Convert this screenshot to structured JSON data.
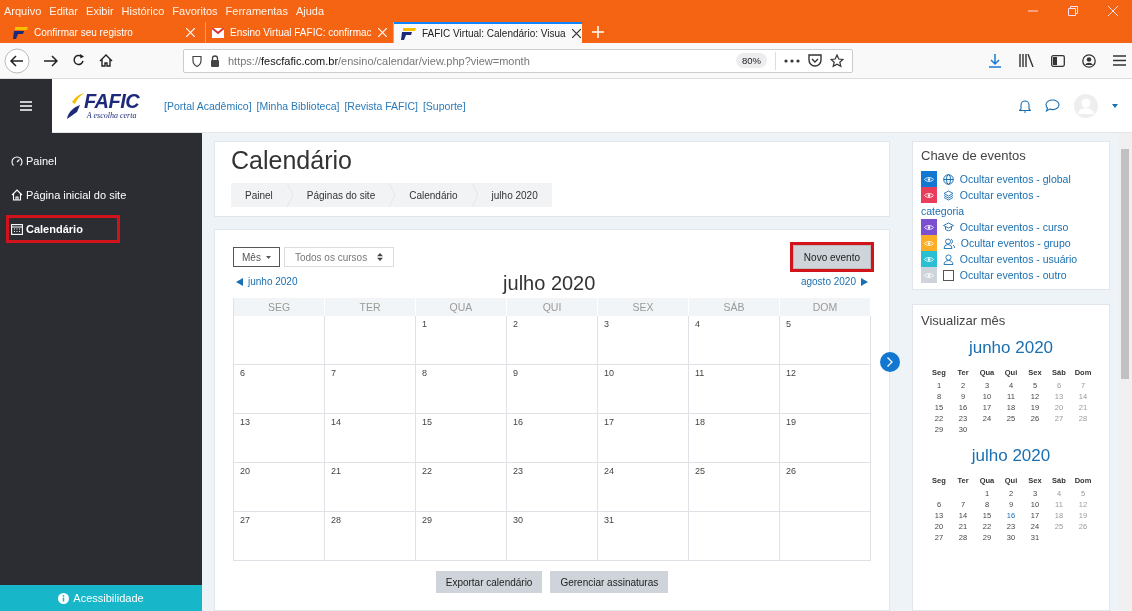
{
  "browser": {
    "menu": [
      "Arquivo",
      "Editar",
      "Exibir",
      "Histórico",
      "Favoritos",
      "Ferramentas",
      "Ajuda"
    ],
    "tabs": [
      {
        "title": "Confirmar seu registro",
        "kind": "fafic",
        "selected": false
      },
      {
        "title": "Ensino Virtual FAFIC: confirmac",
        "kind": "mail",
        "selected": false
      },
      {
        "title": "FAFIC Virtual: Calendário: Visua",
        "kind": "fafic",
        "selected": true
      }
    ],
    "url": "https://**fescfafic.com.br**/ensino/calendar/view.php?view=month",
    "zoom": "80%"
  },
  "navbar": {
    "logo_text": "FAFIC",
    "logo_tagline": "A escolha certa",
    "links": [
      "[Portal Acadêmico]",
      "[Minha Biblioteca]",
      "[Revista FAFIC]",
      "[Suporte]"
    ]
  },
  "sidebar": {
    "items": [
      {
        "label": "Painel",
        "kind": "dashboard",
        "selected": false,
        "annotated": false
      },
      {
        "label": "Página inicial do site",
        "kind": "home",
        "selected": false,
        "annotated": false
      },
      {
        "label": "Calendário",
        "kind": "calendar",
        "selected": true,
        "annotated": true
      }
    ],
    "footer": "Acessibilidade"
  },
  "header": {
    "title": "Calendário",
    "breadcrumbs": [
      "Painel",
      "Páginas do site",
      "Calendário",
      "julho 2020"
    ]
  },
  "calendar": {
    "view_select": "Mês",
    "course_select": "Todos os cursos",
    "new_event": {
      "label": "Novo evento",
      "annotated": true
    },
    "prev": "junho 2020",
    "month": "julho 2020",
    "next": "agosto 2020",
    "weekdays": [
      "SEG",
      "TER",
      "QUA",
      "QUI",
      "SEX",
      "SÁB",
      "DOM"
    ],
    "weeks": [
      [
        {
          "kind": "blank"
        },
        {
          "kind": "blank"
        },
        {
          "kind": "day",
          "d": "1"
        },
        {
          "kind": "day",
          "d": "2"
        },
        {
          "kind": "day",
          "d": "3"
        },
        {
          "kind": "day",
          "d": "4"
        },
        {
          "kind": "day",
          "d": "5"
        }
      ],
      [
        {
          "kind": "day",
          "d": "6"
        },
        {
          "kind": "day",
          "d": "7"
        },
        {
          "kind": "day",
          "d": "8"
        },
        {
          "kind": "day",
          "d": "9"
        },
        {
          "kind": "day",
          "d": "10"
        },
        {
          "kind": "day",
          "d": "11"
        },
        {
          "kind": "day",
          "d": "12"
        }
      ],
      [
        {
          "kind": "day",
          "d": "13"
        },
        {
          "kind": "day",
          "d": "14"
        },
        {
          "kind": "day",
          "d": "15"
        },
        {
          "kind": "day",
          "d": "16"
        },
        {
          "kind": "day",
          "d": "17"
        },
        {
          "kind": "day",
          "d": "18"
        },
        {
          "kind": "day",
          "d": "19"
        }
      ],
      [
        {
          "kind": "day",
          "d": "20"
        },
        {
          "kind": "day",
          "d": "21"
        },
        {
          "kind": "day",
          "d": "22"
        },
        {
          "kind": "day",
          "d": "23"
        },
        {
          "kind": "day",
          "d": "24"
        },
        {
          "kind": "day",
          "d": "25"
        },
        {
          "kind": "day",
          "d": "26"
        }
      ],
      [
        {
          "kind": "day",
          "d": "27"
        },
        {
          "kind": "day",
          "d": "28"
        },
        {
          "kind": "day",
          "d": "29"
        },
        {
          "kind": "day",
          "d": "30"
        },
        {
          "kind": "day",
          "d": "31"
        },
        {
          "kind": "blank"
        },
        {
          "kind": "blank"
        }
      ]
    ],
    "buttons": [
      "Exportar calendário",
      "Gerenciar assinaturas"
    ]
  },
  "event_key": {
    "title": "Chave de eventos",
    "items": [
      {
        "label": "Ocultar eventos - global",
        "kind": "global",
        "color": "#1177d1"
      },
      {
        "label": "Ocultar eventos - categoria",
        "kind": "category",
        "color": "#e83e5c"
      },
      {
        "label": "Ocultar eventos - curso",
        "kind": "course",
        "color": "#7b4fd1"
      },
      {
        "label": "Ocultar eventos - grupo",
        "kind": "group",
        "color": "#fbad26"
      },
      {
        "label": "Ocultar eventos - usuário",
        "kind": "user",
        "color": "#2bbfd3"
      },
      {
        "label": "Ocultar eventos - outro",
        "kind": "other",
        "color": "#ced4da"
      }
    ]
  },
  "month_view": {
    "title": "Visualizar mês",
    "months": [
      {
        "name": "junho 2020",
        "weekdays": [
          "Seg",
          "Ter",
          "Qua",
          "Qui",
          "Sex",
          "Sáb",
          "Dom"
        ],
        "weeks": [
          [
            {
              "kind": "day",
              "d": "1",
              "today": false
            },
            {
              "kind": "day",
              "d": "2",
              "today": false
            },
            {
              "kind": "day",
              "d": "3",
              "today": false
            },
            {
              "kind": "day",
              "d": "4",
              "today": false
            },
            {
              "kind": "day",
              "d": "5",
              "today": false
            },
            {
              "kind": "day",
              "d": "6",
              "today": false
            },
            {
              "kind": "day",
              "d": "7",
              "today": false
            }
          ],
          [
            {
              "kind": "day",
              "d": "8",
              "today": false
            },
            {
              "kind": "day",
              "d": "9",
              "today": false
            },
            {
              "kind": "day",
              "d": "10",
              "today": false
            },
            {
              "kind": "day",
              "d": "11",
              "today": false
            },
            {
              "kind": "day",
              "d": "12",
              "today": false
            },
            {
              "kind": "day",
              "d": "13",
              "today": false
            },
            {
              "kind": "day",
              "d": "14",
              "today": false
            }
          ],
          [
            {
              "kind": "day",
              "d": "15",
              "today": false
            },
            {
              "kind": "day",
              "d": "16",
              "today": false
            },
            {
              "kind": "day",
              "d": "17",
              "today": false
            },
            {
              "kind": "day",
              "d": "18",
              "today": false
            },
            {
              "kind": "day",
              "d": "19",
              "today": false
            },
            {
              "kind": "day",
              "d": "20",
              "today": false
            },
            {
              "kind": "day",
              "d": "21",
              "today": false
            }
          ],
          [
            {
              "kind": "day",
              "d": "22",
              "today": false
            },
            {
              "kind": "day",
              "d": "23",
              "today": false
            },
            {
              "kind": "day",
              "d": "24",
              "today": false
            },
            {
              "kind": "day",
              "d": "25",
              "today": false
            },
            {
              "kind": "day",
              "d": "26",
              "today": false
            },
            {
              "kind": "day",
              "d": "27",
              "today": false
            },
            {
              "kind": "day",
              "d": "28",
              "today": false
            }
          ],
          [
            {
              "kind": "day",
              "d": "29",
              "today": false
            },
            {
              "kind": "day",
              "d": "30",
              "today": false
            },
            {
              "kind": "blank"
            },
            {
              "kind": "blank"
            },
            {
              "kind": "blank"
            },
            {
              "kind": "blank"
            },
            {
              "kind": "blank"
            }
          ]
        ]
      },
      {
        "name": "julho 2020",
        "weekdays": [
          "Seg",
          "Ter",
          "Qua",
          "Qui",
          "Sex",
          "Sáb",
          "Dom"
        ],
        "weeks": [
          [
            {
              "kind": "blank"
            },
            {
              "kind": "blank"
            },
            {
              "kind": "day",
              "d": "1",
              "today": false
            },
            {
              "kind": "day",
              "d": "2",
              "today": false
            },
            {
              "kind": "day",
              "d": "3",
              "today": false
            },
            {
              "kind": "day",
              "d": "4",
              "today": false
            },
            {
              "kind": "day",
              "d": "5",
              "today": false
            }
          ],
          [
            {
              "kind": "day",
              "d": "6",
              "today": false
            },
            {
              "kind": "day",
              "d": "7",
              "today": false
            },
            {
              "kind": "day",
              "d": "8",
              "today": false
            },
            {
              "kind": "day",
              "d": "9",
              "today": false
            },
            {
              "kind": "day",
              "d": "10",
              "today": false
            },
            {
              "kind": "day",
              "d": "11",
              "today": false
            },
            {
              "kind": "day",
              "d": "12",
              "today": false
            }
          ],
          [
            {
              "kind": "day",
              "d": "13",
              "today": false
            },
            {
              "kind": "day",
              "d": "14",
              "today": false
            },
            {
              "kind": "day",
              "d": "15",
              "today": false
            },
            {
              "kind": "day",
              "d": "16",
              "today": true
            },
            {
              "kind": "day",
              "d": "17",
              "today": false
            },
            {
              "kind": "day",
              "d": "18",
              "today": false
            },
            {
              "kind": "day",
              "d": "19",
              "today": false
            }
          ],
          [
            {
              "kind": "day",
              "d": "20",
              "today": false
            },
            {
              "kind": "day",
              "d": "21",
              "today": false
            },
            {
              "kind": "day",
              "d": "22",
              "today": false
            },
            {
              "kind": "day",
              "d": "23",
              "today": false
            },
            {
              "kind": "day",
              "d": "24",
              "today": false
            },
            {
              "kind": "day",
              "d": "25",
              "today": false
            },
            {
              "kind": "day",
              "d": "26",
              "today": false
            }
          ],
          [
            {
              "kind": "day",
              "d": "27",
              "today": false
            },
            {
              "kind": "day",
              "d": "28",
              "today": false
            },
            {
              "kind": "day",
              "d": "29",
              "today": false
            },
            {
              "kind": "day",
              "d": "30",
              "today": false
            },
            {
              "kind": "day",
              "d": "31",
              "today": false
            },
            {
              "kind": "blank"
            },
            {
              "kind": "blank"
            }
          ]
        ]
      }
    ]
  }
}
